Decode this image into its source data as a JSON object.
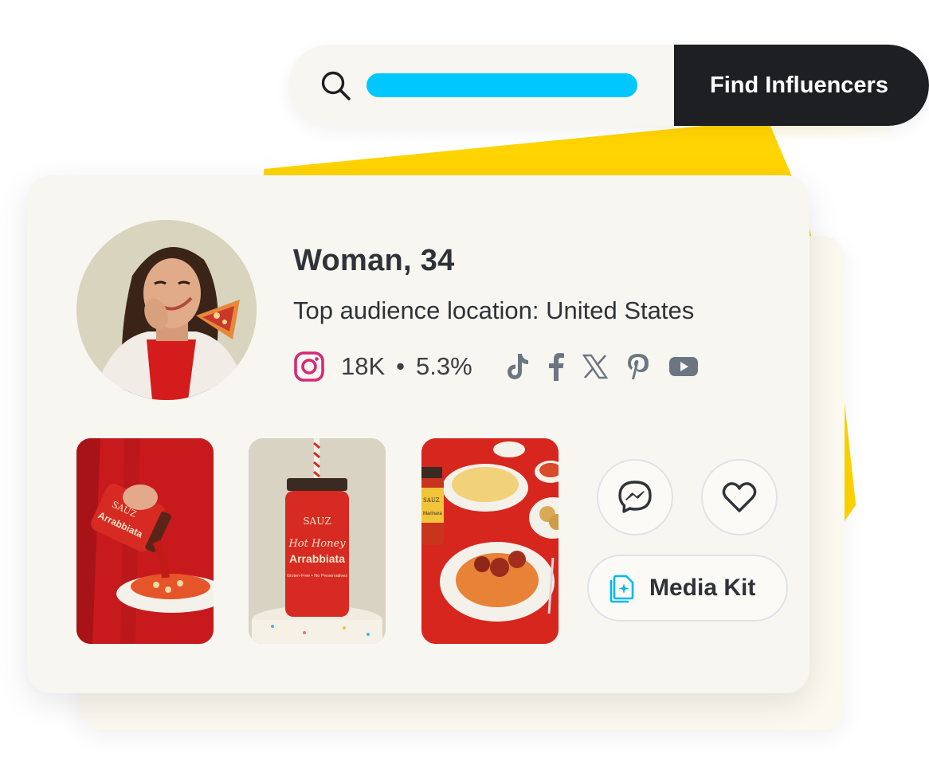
{
  "search": {
    "placeholder": "",
    "button_label": "Find Influencers"
  },
  "profile": {
    "title": "Woman, 34",
    "location": "Top audience location: United States",
    "instagram_followers": "18K",
    "separator": "•",
    "engagement_rate": "5.3%"
  },
  "social_icons": [
    "tiktok-icon",
    "facebook-icon",
    "x-icon",
    "pinterest-icon",
    "youtube-icon"
  ],
  "photos": {
    "photo1_jar_brand": "SAUZ",
    "photo1_jar_text": "Arrabbiata",
    "photo2_jar_brand": "SAUZ",
    "photo2_jar_line1": "Hot Honey",
    "photo2_jar_line2": "Arrabbiata",
    "photo2_jar_small": "Gluten-Free • No Preservatives",
    "photo3_jar_brand": "SAUZ",
    "photo3_jar_text": "Marinara"
  },
  "actions": {
    "media_kit_label": "Media Kit"
  },
  "colors": {
    "accent_yellow": "#FFD400",
    "search_bar_fill": "#00C8FF",
    "button_dark": "#1d1f22",
    "instagram": "#D62976",
    "icon_gray": "#5f6b78",
    "media_kit_icon": "#00B8F0"
  }
}
